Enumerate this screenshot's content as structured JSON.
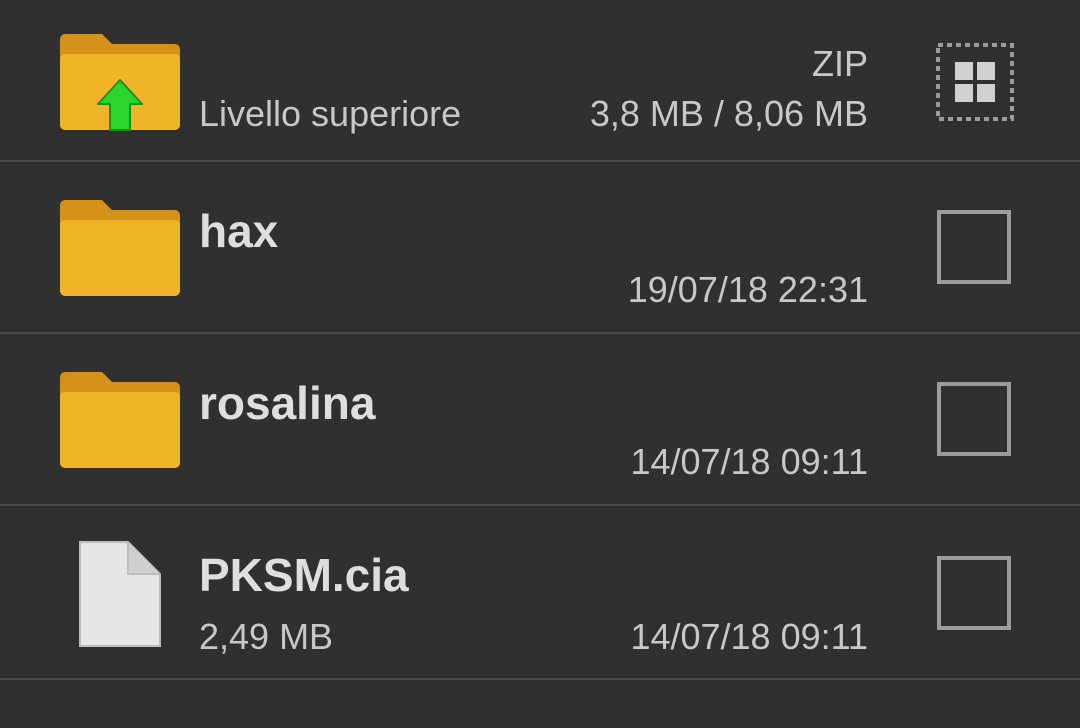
{
  "parent_row": {
    "label": "Livello superiore",
    "type_label": "ZIP",
    "size_label": "3,8 MB / 8,06 MB",
    "icon": "folder-up-icon",
    "select_all_icon": "select-all-grid-icon"
  },
  "items": [
    {
      "name": "hax",
      "date": "19/07/18 22:31",
      "size": "",
      "icon": "folder-icon"
    },
    {
      "name": "rosalina",
      "date": "14/07/18 09:11",
      "size": "",
      "icon": "folder-icon"
    },
    {
      "name": "PKSM.cia",
      "date": "14/07/18 09:11",
      "size": "2,49 MB",
      "icon": "file-icon"
    }
  ],
  "colors": {
    "background": "#303030",
    "divider": "#4a4a4a",
    "folder": "#f0b429",
    "folder_tab": "#d4921a",
    "up_arrow": "#2bd62b",
    "file": "#e6e6e6",
    "checkbox": "#9c9c9c"
  }
}
